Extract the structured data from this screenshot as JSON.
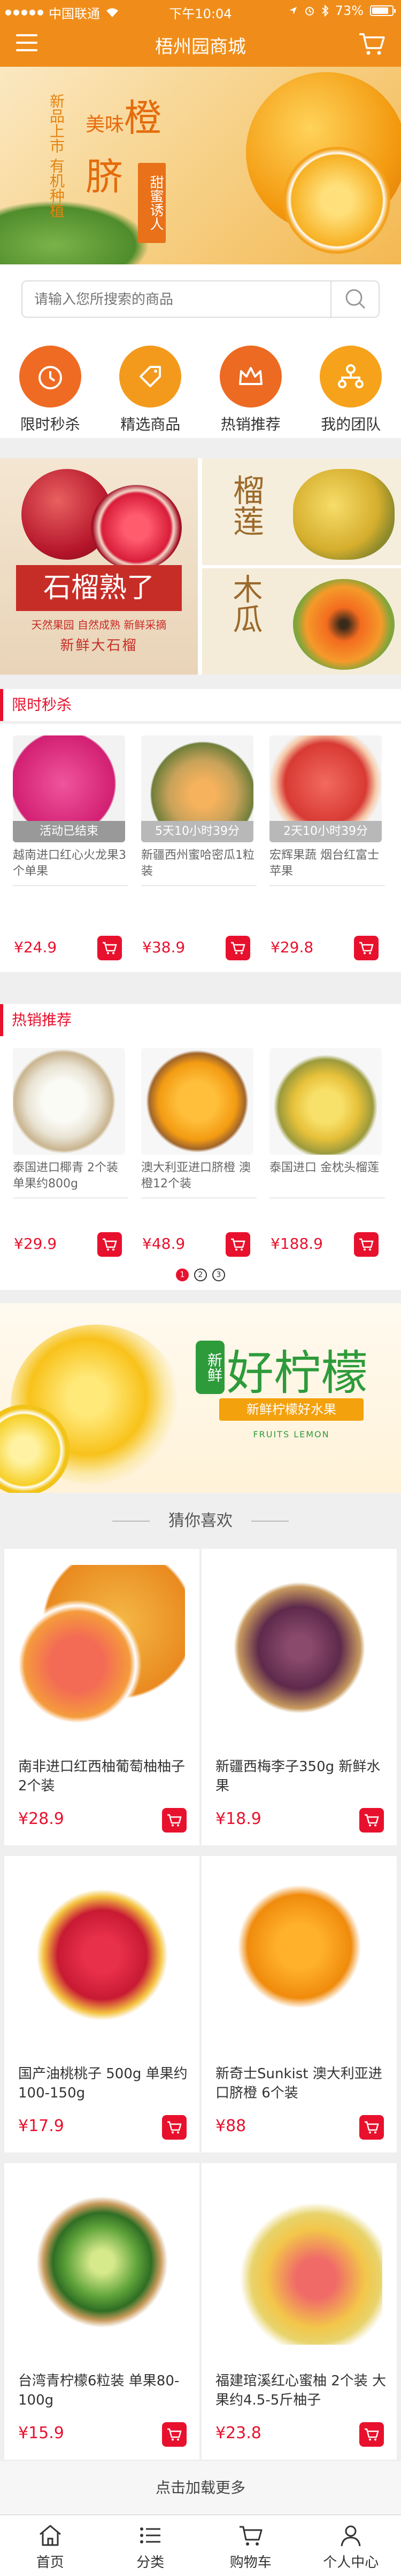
{
  "status": {
    "carrier": "中国联通",
    "time": "下午10:04",
    "battery": "73%"
  },
  "header": {
    "title": "梧州园商城"
  },
  "banner": {
    "tag_small": "新品上市 有机种植",
    "word1": "美味",
    "big1": "橙",
    "big2": "脐",
    "stamp": "甜蜜诱人"
  },
  "search": {
    "placeholder": "请输入您所搜索的商品"
  },
  "quicknav": [
    {
      "label": "限时秒杀",
      "icon": "clock-icon"
    },
    {
      "label": "精选商品",
      "icon": "tag-icon"
    },
    {
      "label": "热销推荐",
      "icon": "crown-icon"
    },
    {
      "label": "我的团队",
      "icon": "team-icon"
    }
  ],
  "promo": {
    "pom_title": "石榴熟了",
    "pom_badges": "天然果园 自然成熟 新鲜采摘",
    "pom_sub": "新鲜大石榴",
    "durian": "榴莲",
    "papaya": "木瓜"
  },
  "flash": {
    "title": "限时秒杀",
    "items": [
      {
        "tag": "活动已结束",
        "name": "越南进口红心火龙果3个单果",
        "price": "¥24.9"
      },
      {
        "tag": "5天10小时39分",
        "name": "新疆西州蜜哈密瓜1粒装",
        "price": "¥38.9"
      },
      {
        "tag": "2天10小时39分",
        "name": "宏辉果蔬 烟台红富士苹果",
        "price": "¥29.8"
      }
    ]
  },
  "hot": {
    "title": "热销推荐",
    "items": [
      {
        "name": "泰国进口椰青 2个装 单果约800g",
        "price": "¥29.9"
      },
      {
        "name": "澳大利亚进口脐橙 澳橙12个装",
        "price": "¥48.9"
      },
      {
        "name": "泰国进口 金枕头榴莲",
        "price": "¥188.9"
      }
    ],
    "pages": [
      "1",
      "2",
      "3"
    ]
  },
  "lemon": {
    "new_tag": "新鲜",
    "title": "好柠檬",
    "pill": "新鲜柠檬好水果",
    "en": "FRUITS LEMON"
  },
  "guess": {
    "title": "猜你喜欢",
    "items": [
      {
        "name": "南非进口红西柚葡萄柚柚子 2个装",
        "price": "¥28.9"
      },
      {
        "name": "新疆西梅李子350g 新鲜水果",
        "price": "¥18.9"
      },
      {
        "name": "国产油桃桃子 500g 单果约100-150g",
        "price": "¥17.9"
      },
      {
        "name": "新奇士Sunkist 澳大利亚进口脐橙 6个装",
        "price": "¥88"
      },
      {
        "name": "台湾青柠檬6粒装 单果80-100g",
        "price": "¥15.9"
      },
      {
        "name": "福建琯溪红心蜜柚 2个装 大果约4.5-5斤柚子",
        "price": "¥23.8"
      }
    ],
    "load_more": "点击加载更多"
  },
  "tabbar": [
    {
      "label": "首页",
      "icon": "home-icon"
    },
    {
      "label": "分类",
      "icon": "list-icon"
    },
    {
      "label": "购物车",
      "icon": "cart-icon"
    },
    {
      "label": "个人中心",
      "icon": "user-icon"
    }
  ],
  "colors": {
    "brand": "#f08d1a",
    "accent": "#e8112d"
  }
}
